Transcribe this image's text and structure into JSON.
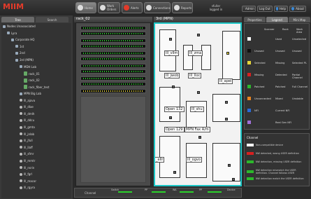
{
  "app": {
    "logo": "MIIM"
  },
  "toolbar": {
    "buttons": [
      {
        "label": "Home"
      },
      {
        "label": "Work Orders"
      },
      {
        "label": "Alerts"
      },
      {
        "label": "Connections"
      },
      {
        "label": "Reports"
      }
    ],
    "user_line1": "sfuller",
    "user_line2": "logged in",
    "admin": "Admin",
    "logout": "Log Out",
    "help": "Help",
    "about": "About"
  },
  "left": {
    "tabs": [
      "Tree",
      "Search"
    ],
    "tree": [
      {
        "label": "Nodes Unassociated",
        "indent": 0,
        "kind": "folder"
      },
      {
        "label": "Lyra",
        "indent": 1,
        "kind": "folder"
      },
      {
        "label": "Corporate HQ",
        "indent": 2,
        "kind": "folder"
      },
      {
        "label": "1st",
        "indent": 3,
        "kind": "folder"
      },
      {
        "label": "2nd",
        "indent": 3,
        "kind": "folder"
      },
      {
        "label": "3rd (MPN)",
        "indent": 3,
        "kind": "folder"
      },
      {
        "label": "MDH Lab",
        "indent": 4,
        "kind": "folder"
      },
      {
        "label": "rack_01",
        "indent": 5,
        "kind": "rack"
      },
      {
        "label": "rack_02",
        "indent": 5,
        "kind": "rack"
      },
      {
        "label": "rack_fiber_test",
        "indent": 5,
        "kind": "rack"
      },
      {
        "label": "MPN Big Lab",
        "indent": 4,
        "kind": "folder"
      },
      {
        "label": "lll_ajava",
        "indent": 4,
        "kind": "switch"
      },
      {
        "label": "lll_dlae",
        "indent": 4,
        "kind": "switch"
      },
      {
        "label": "lll_dmlh",
        "indent": 4,
        "kind": "switch"
      },
      {
        "label": "lll_ddcu",
        "indent": 4,
        "kind": "switch"
      },
      {
        "label": "lll_gmta",
        "indent": 4,
        "kind": "switch"
      },
      {
        "label": "lll_jnlab",
        "indent": 4,
        "kind": "switch"
      },
      {
        "label": "lll_jfull",
        "indent": 4,
        "kind": "switch"
      },
      {
        "label": "lll_llaff",
        "indent": 4,
        "kind": "switch"
      },
      {
        "label": "lll_sfmr",
        "indent": 4,
        "kind": "switch"
      },
      {
        "label": "lll_mmtr",
        "indent": 4,
        "kind": "switch"
      },
      {
        "label": "lll_nsrin",
        "indent": 4,
        "kind": "switch"
      },
      {
        "label": "lll_fgrl",
        "indent": 4,
        "kind": "switch"
      },
      {
        "label": "lll_macor",
        "indent": 4,
        "kind": "switch"
      },
      {
        "label": "lll_rgyra",
        "indent": 4,
        "kind": "switch"
      }
    ]
  },
  "rack": {
    "title": "rack_02"
  },
  "floor": {
    "title": "3rd (MPN)",
    "labels": [
      {
        "text": "lll_vllm"
      },
      {
        "text": "lll_zma"
      },
      {
        "text": "lll_jwob"
      },
      {
        "text": "lll_lloc"
      },
      {
        "text": "lll_apei"
      },
      {
        "text": "Open 132"
      },
      {
        "text": "lll_shu"
      },
      {
        "text": "Open 129"
      },
      {
        "text": "MPN Fax A/m"
      },
      {
        "text": "lll_ogvo"
      },
      {
        "text": "_ellr"
      }
    ]
  },
  "right": {
    "tabs": [
      "Properties",
      "Legend",
      "Mini Map"
    ],
    "legend_headers": [
      "Scanner",
      "Rack",
      "Work Area"
    ],
    "legend_rows": [
      {
        "c1": "Used",
        "c2": "Unselected",
        "color": "#ffffff"
      },
      {
        "c0": "Unused",
        "c1": "Unused",
        "c2": "Unused",
        "color": "#111111"
      },
      {
        "c0": "Selected",
        "c1": "Missing",
        "c2": "Selected PL",
        "color": "#e5d43a"
      },
      {
        "c0": "Missing",
        "c1": "Detected",
        "c2": "Partial Channel",
        "color": "#d82020"
      },
      {
        "c0": "Patched",
        "c1": "Patched",
        "c2": "Full Channel",
        "color": "#2bb82b"
      },
      {
        "c0": "Unconnected",
        "c1": "Mixed",
        "c2": "Unstable",
        "color": "#e88420"
      },
      {
        "c0": "NFI",
        "c1": "Current NFI",
        "color": "#2a6ad8"
      },
      {
        "c1": "Real Gen NFI",
        "color": "#a070d8"
      }
    ],
    "channel_title": "Channel",
    "channel_rows": [
      {
        "text": "Non-compatible device",
        "color": "#ffffff"
      },
      {
        "text": "NW detected, wrong USER definition",
        "color": "#d82020"
      },
      {
        "text": "NW detection, missing USER definition",
        "color": "#2bb82b"
      },
      {
        "text": "NW detection mismatch the USER definition. Channel follows USER",
        "color": "#2bb82b"
      },
      {
        "text": "NW detection match the USER definition",
        "color": "#2bb82b"
      }
    ]
  },
  "bottom": {
    "channel": "Channel",
    "labels": [
      "Switch",
      "PP",
      "WA",
      "PP",
      "Device"
    ]
  }
}
